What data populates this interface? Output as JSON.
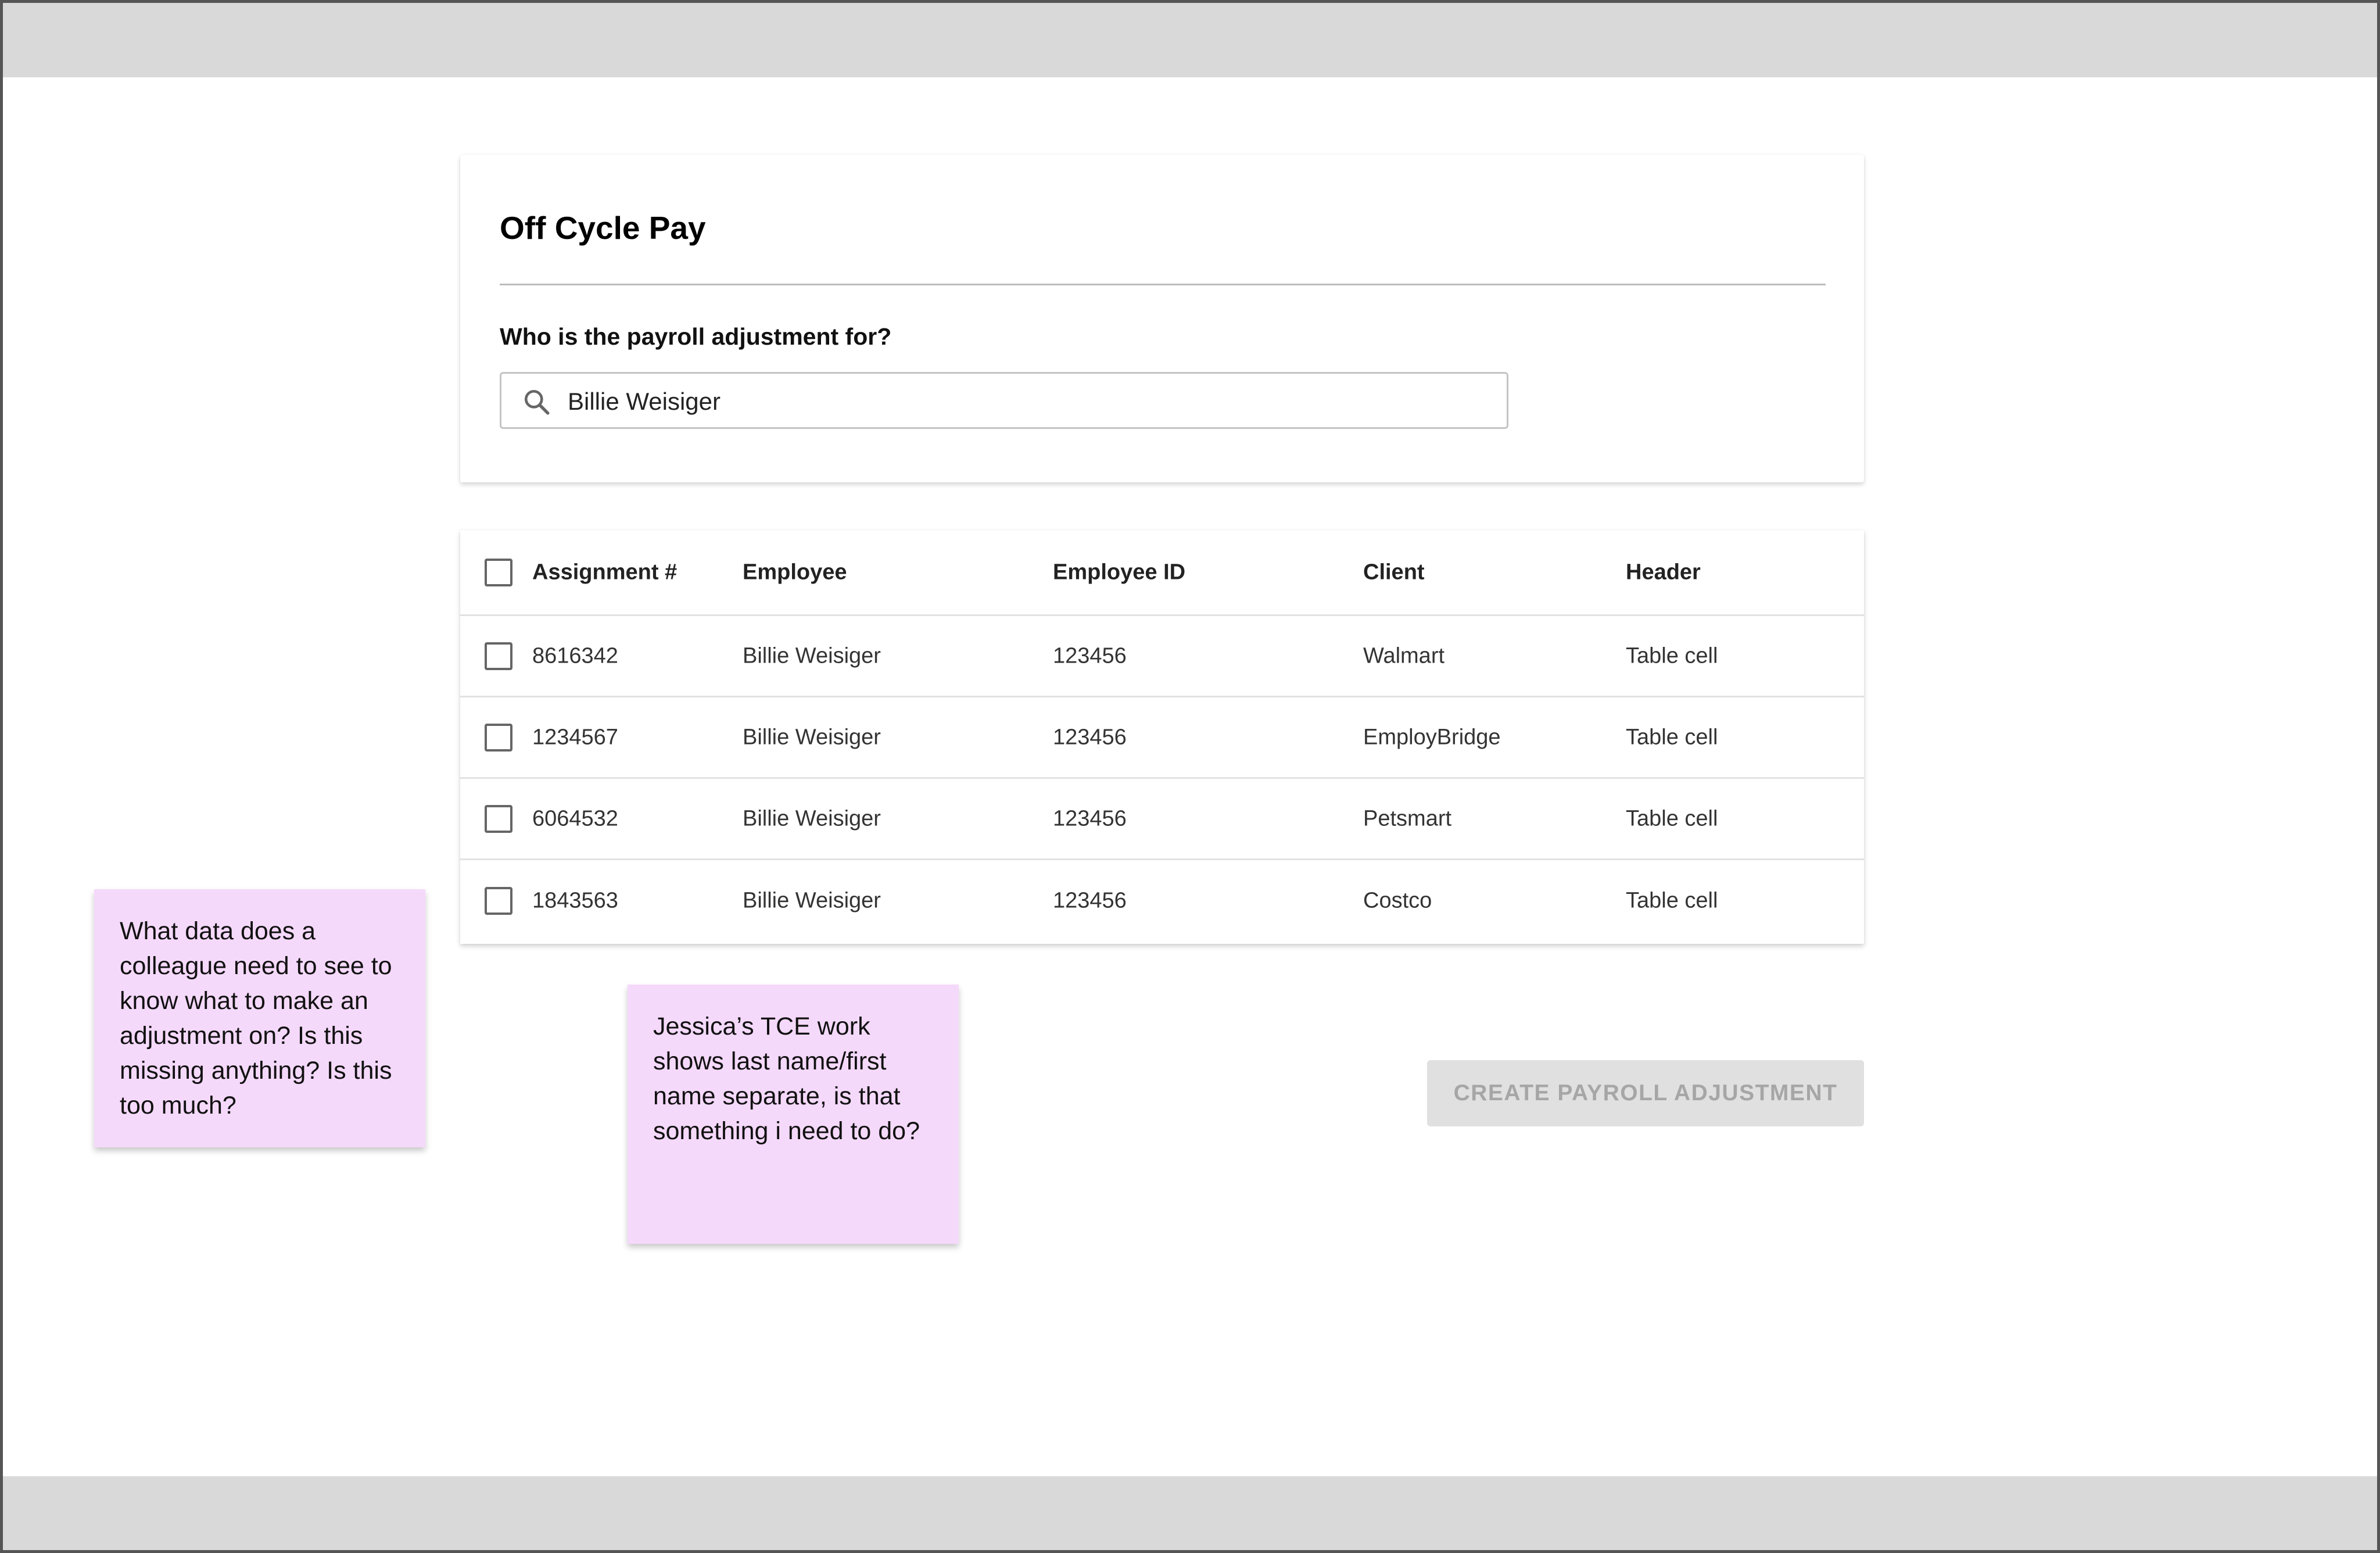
{
  "card": {
    "title": "Off Cycle Pay",
    "question": "Who is the payroll adjustment for?"
  },
  "search": {
    "icon": "search-icon",
    "value": "Billie Weisiger"
  },
  "table": {
    "headers": [
      "Assignment #",
      "Employee",
      "Employee ID",
      "Client",
      "Header"
    ],
    "rows": [
      {
        "assignment": "8616342",
        "employee": "Billie Weisiger",
        "employee_id": "123456",
        "client": "Walmart",
        "header": "Table cell"
      },
      {
        "assignment": "1234567",
        "employee": "Billie Weisiger",
        "employee_id": "123456",
        "client": "EmployBridge",
        "header": "Table cell"
      },
      {
        "assignment": "6064532",
        "employee": "Billie Weisiger",
        "employee_id": "123456",
        "client": "Petsmart",
        "header": "Table cell"
      },
      {
        "assignment": "1843563",
        "employee": "Billie Weisiger",
        "employee_id": "123456",
        "client": "Costco",
        "header": "Table cell"
      }
    ]
  },
  "notes": [
    "What data does a colleague need to see to know what to make an adjustment on? Is this missing anything? Is this too much?",
    "Jessica’s TCE work shows last name/first name separate, is that something i need to do?"
  ],
  "actions": {
    "create_label": "CREATE PAYROLL ADJUSTMENT"
  },
  "colors": {
    "chrome_bar": "#d9d9d9",
    "sticky": "#f5d9fb",
    "button_disabled_bg": "#e0e0e0",
    "button_disabled_text": "#a6a6a6"
  }
}
